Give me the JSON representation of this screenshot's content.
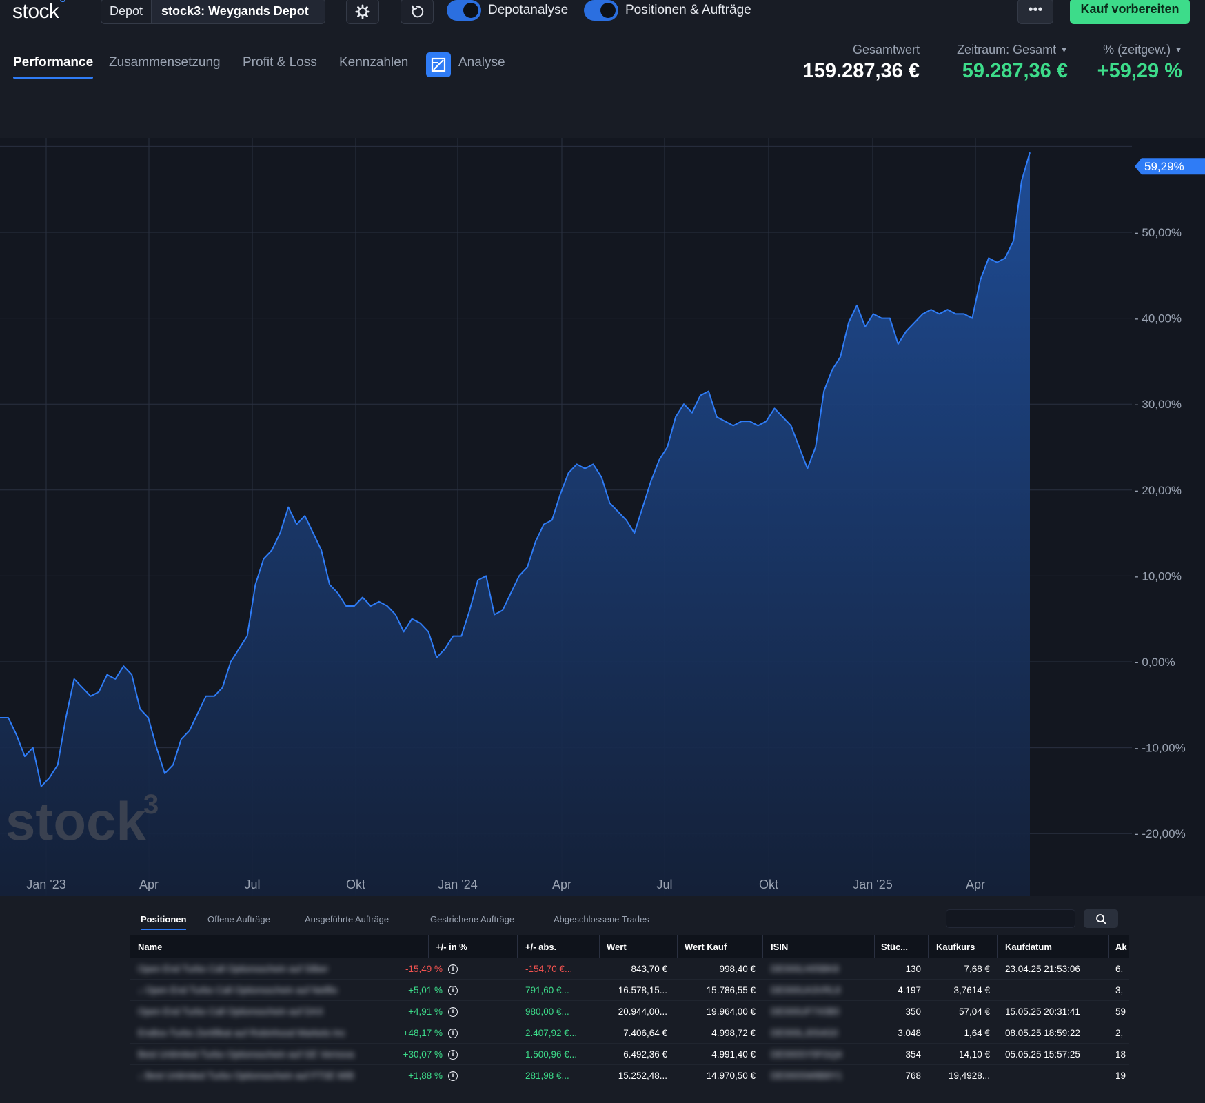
{
  "app": {
    "logo_text": "stock",
    "logo_sup": "3"
  },
  "toolbar": {
    "depot_label": "Depot",
    "depot_value": "stock3: Weygands Depot",
    "toggle1_label": "Depotanalyse",
    "toggle2_label": "Positionen & Aufträge",
    "more_label": "•••",
    "buy_label": "Kauf vorbereiten"
  },
  "tabs": [
    {
      "label": "Performance",
      "active": true
    },
    {
      "label": "Zusammensetzung"
    },
    {
      "label": "Profit & Loss"
    },
    {
      "label": "Kennzahlen"
    },
    {
      "label": "Analyse"
    }
  ],
  "kpis": {
    "total_label": "Gesamtwert",
    "total_value": "159.287,36 €",
    "period_label": "Zeitraum: Gesamt",
    "period_value": "59.287,36 €",
    "pct_label": "% (zeitgew.)",
    "pct_value": "+59,29 %"
  },
  "chart_data": {
    "type": "area",
    "y_unit": "%",
    "ylim": [
      -27,
      61
    ],
    "y_ticks": [
      "-20,00%",
      "-10,00%",
      "0,00%",
      "10,00%",
      "20,00%",
      "30,00%",
      "40,00%",
      "50,00%"
    ],
    "x_ticks": [
      "Jan '23",
      "Apr",
      "Jul",
      "Okt",
      "Jan '24",
      "Apr",
      "Jul",
      "Okt",
      "Jan '25",
      "Apr"
    ],
    "last_value_label": "59,29%",
    "watermark": "stock",
    "watermark_sup": "3",
    "series": [
      {
        "values_pct": [
          -6.5,
          -6.5,
          -8.5,
          -11.0,
          -10.0,
          -14.5,
          -13.5,
          -12.0,
          -6.5,
          -2.0,
          -3.0,
          -4.0,
          -3.5,
          -1.5,
          -2.0,
          -0.5,
          -1.5,
          -5.5,
          -6.5,
          -10.0,
          -13.0,
          -12.0,
          -9.0,
          -8.0,
          -6.0,
          -4.0,
          -4.0,
          -3.0,
          0.0,
          1.5,
          3.0,
          9.0,
          12.0,
          13.0,
          15.0,
          18.0,
          16.0,
          17.0,
          15.0,
          13.0,
          9.0,
          8.0,
          6.5,
          6.5,
          7.5,
          6.5,
          7.0,
          6.5,
          5.5,
          3.5,
          5.0,
          4.5,
          3.5,
          0.5,
          1.5,
          3.0,
          3.0,
          6.0,
          9.5,
          10.0,
          5.5,
          6.0,
          8.0,
          10.0,
          11.0,
          14.0,
          16.0,
          16.5,
          19.5,
          22.0,
          23.0,
          22.5,
          23.0,
          21.5,
          18.5,
          17.5,
          16.5,
          15.0,
          18.0,
          21.0,
          23.5,
          25.0,
          28.5,
          30.0,
          29.0,
          31.0,
          31.5,
          28.5,
          28.0,
          27.5,
          28.0,
          28.0,
          27.5,
          28.0,
          29.5,
          28.5,
          27.5,
          25.0,
          22.5,
          25.0,
          31.5,
          34.0,
          35.5,
          39.5,
          41.5,
          39.0,
          40.5,
          40.0,
          40.0,
          37.0,
          38.5,
          39.5,
          40.5,
          41.0,
          40.5,
          41.0,
          40.5,
          40.5,
          40.0,
          44.5,
          47.0,
          46.5,
          47.0,
          49.0,
          56.0,
          59.29
        ]
      }
    ]
  },
  "panel": {
    "subtabs": [
      {
        "label": "Positionen",
        "active": true
      },
      {
        "label": "Offene Aufträge"
      },
      {
        "label": "Ausgeführte Aufträge"
      },
      {
        "label": "Gestrichene Aufträge"
      },
      {
        "label": "Abgeschlossene Trades"
      }
    ],
    "search": {
      "value": ""
    },
    "columns": [
      "Name",
      "+/- in %",
      "+/- abs.",
      "Wert",
      "Wert Kauf",
      "ISIN",
      "Stüc...",
      "Kaufkurs",
      "Kaufdatum",
      "Ak"
    ],
    "rows": [
      {
        "name": "Open End Turbo Call Optionsschein auf Silber",
        "pct": "-15,49 %",
        "pct_sign": "neg",
        "abs": "-154,70 €...",
        "wert": "843,70 €",
        "wert_kauf": "998,40 €",
        "isin": "DE000LH05BK8",
        "stueck": "130",
        "kaufkurs": "7,68 €",
        "kaufdatum": "23.04.25 21:53:06",
        "ak": "6,"
      },
      {
        "name": "↓ Open End Turbo Call Optionsschein auf Netflix",
        "pct": "+5,01 %",
        "pct_sign": "pos",
        "abs": "791,60 €...",
        "wert": "16.578,15...",
        "wert_kauf": "15.786,55 €",
        "isin": "DE000UA3VRL8",
        "stueck": "4.197",
        "kaufkurs": "3,7614 €",
        "kaufdatum": "",
        "ak": "3,"
      },
      {
        "name": "Open End Turbo Call Optionsschein auf DAX",
        "pct": "+4,91 %",
        "pct_sign": "pos",
        "abs": "980,00 €...",
        "wert": "20.944,00...",
        "wert_kauf": "19.964,00 €",
        "isin": "DE000UF7X0B0",
        "stueck": "350",
        "kaufkurs": "57,04 €",
        "kaufdatum": "15.05.25 20:31:41",
        "ak": "59"
      },
      {
        "name": "Endlos-Turbo Zertifikat auf Robinhood Markets Inc",
        "pct": "+48,17 %",
        "pct_sign": "pos",
        "abs": "2.407,92 €...",
        "wert": "7.406,64 €",
        "wert_kauf": "4.998,72 €",
        "isin": "DE000LJ0S4G0",
        "stueck": "3.048",
        "kaufkurs": "1,64 €",
        "kaufdatum": "08.05.25 18:59:22",
        "ak": "2,"
      },
      {
        "name": "Best Unlimited Turbo Optionsschein auf GE Vernova",
        "pct": "+30,07 %",
        "pct_sign": "pos",
        "abs": "1.500,96 €...",
        "wert": "6.492,36 €",
        "wert_kauf": "4.991,40 €",
        "isin": "DE000SY5FGQ4",
        "stueck": "354",
        "kaufkurs": "14,10 €",
        "kaufdatum": "05.05.25 15:57:25",
        "ak": "18"
      },
      {
        "name": "↓ Best Unlimited Turbo Optionsschein auf FTSE MIB",
        "pct": "+1,88 %",
        "pct_sign": "pos",
        "abs": "281,98 €...",
        "wert": "15.252,48...",
        "wert_kauf": "14.970,50 €",
        "isin": "DE000SW8B8Y1",
        "stueck": "768",
        "kaufkurs": "19,4928...",
        "kaufdatum": "",
        "ak": "19"
      }
    ]
  },
  "colors": {
    "accent": "#2f7cf6",
    "positive": "#3ddc8a",
    "negative": "#f0524f",
    "chart_line": "#2f7cf6",
    "background": "#181c25",
    "chart_background": "#131720"
  }
}
